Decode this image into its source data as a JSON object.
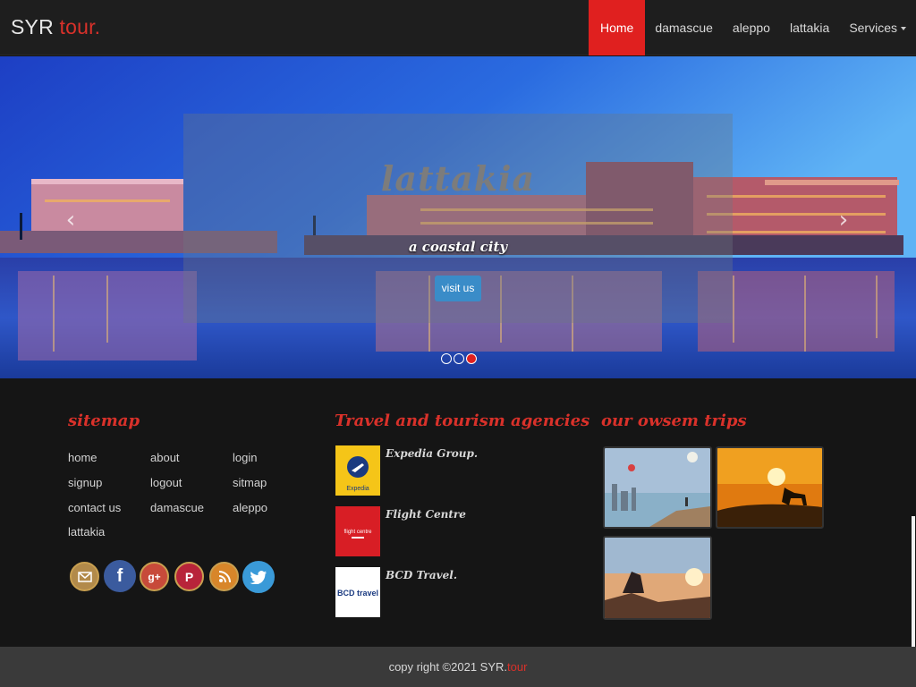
{
  "brand": {
    "part1": "SYR",
    "part2": "tour."
  },
  "nav": {
    "home": "Home",
    "damascue": "damascue",
    "aleppo": "aleppo",
    "lattakia": "lattakia",
    "services": "Services"
  },
  "carousel": {
    "title": "lattakia",
    "subtitle": "a coastal city",
    "button": "visit us",
    "prev": "‹",
    "next": "›",
    "slides_count": 3,
    "active_slide": 3
  },
  "sitemap": {
    "heading": "sitemap",
    "links": [
      "home",
      "about",
      "login",
      "signup",
      "logout",
      "sitmap",
      "contact us",
      "damascue",
      "aleppo",
      "lattakia"
    ]
  },
  "social": [
    "email-icon",
    "facebook-icon",
    "google-plus-icon",
    "pinterest-icon",
    "rss-icon",
    "twitter-icon"
  ],
  "agencies": {
    "heading": "Travel and tourism agencies",
    "items": [
      {
        "name": "Expedia Group.",
        "logo_text": "Expedia"
      },
      {
        "name": "Flight Centre",
        "logo_text": "flight centre"
      },
      {
        "name": "BCD Travel.",
        "logo_text": "BCD travel"
      }
    ]
  },
  "trips": {
    "heading": "our owsem trips"
  },
  "footer": {
    "copyright": "copy right ©2021 SYR.",
    "brand_accent": "tour"
  },
  "colors": {
    "accent": "#e0201f",
    "nav_bg": "#1e1e1e",
    "footer_bg": "#151515",
    "button": "#3a8cc8"
  }
}
